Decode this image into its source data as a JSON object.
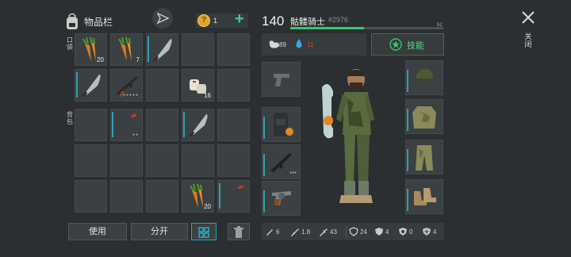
{
  "inventory": {
    "title": "物品栏",
    "coins": "1"
  },
  "sections": {
    "pockets": "口袋",
    "backpack": "背包"
  },
  "player": {
    "level": "140",
    "name": "骷髅骑士",
    "id": "#2976",
    "xp": "52",
    "xp_fraction": 0.48
  },
  "status": {
    "food": "89",
    "water": "11",
    "skills_label": "技能"
  },
  "close_label": "关闭",
  "buttons": {
    "use": "使用",
    "split": "分开"
  },
  "pocket_items": [
    {
      "icon": "carrot-icon",
      "qty": "20"
    },
    {
      "icon": "carrot-icon",
      "qty": "7"
    },
    {
      "icon": "machete-icon",
      "qty": ""
    },
    {
      "icon": "empty",
      "qty": ""
    },
    {
      "icon": "empty",
      "qty": ""
    },
    {
      "icon": "machete-icon",
      "qty": ""
    },
    {
      "icon": "rifle-icon",
      "qty": ""
    },
    {
      "icon": "empty",
      "qty": ""
    },
    {
      "icon": "bandage-icon",
      "qty": "16"
    },
    {
      "icon": "empty",
      "qty": ""
    }
  ],
  "backpack_items": [
    {
      "icon": "empty",
      "qty": ""
    },
    {
      "icon": "crowbar-icon",
      "qty": ""
    },
    {
      "icon": "empty",
      "qty": ""
    },
    {
      "icon": "machete-icon",
      "qty": ""
    },
    {
      "icon": "empty",
      "qty": ""
    },
    {
      "icon": "empty",
      "qty": ""
    },
    {
      "icon": "empty",
      "qty": ""
    },
    {
      "icon": "empty",
      "qty": ""
    },
    {
      "icon": "empty",
      "qty": ""
    },
    {
      "icon": "empty",
      "qty": ""
    },
    {
      "icon": "empty",
      "qty": ""
    },
    {
      "icon": "empty",
      "qty": ""
    },
    {
      "icon": "empty",
      "qty": ""
    },
    {
      "icon": "carrot-icon",
      "qty": "20"
    },
    {
      "icon": "crowbar-icon",
      "qty": ""
    }
  ],
  "stats": [
    {
      "icon": "melee-icon",
      "value": "6"
    },
    {
      "icon": "firearm-icon",
      "value": "1.8"
    },
    {
      "icon": "ranged-icon",
      "value": "43"
    },
    {
      "icon": "armor-icon",
      "value": "24"
    },
    {
      "icon": "shield-icon",
      "value": "4"
    },
    {
      "icon": "radiation-icon",
      "value": "0"
    },
    {
      "icon": "cold-icon",
      "value": "4"
    }
  ],
  "colors": {
    "accent": "#2fa0b4",
    "green": "#3cc66b",
    "coin": "#e0a52a",
    "water": "#3aa7d9",
    "water_value": "#d84a3c"
  }
}
